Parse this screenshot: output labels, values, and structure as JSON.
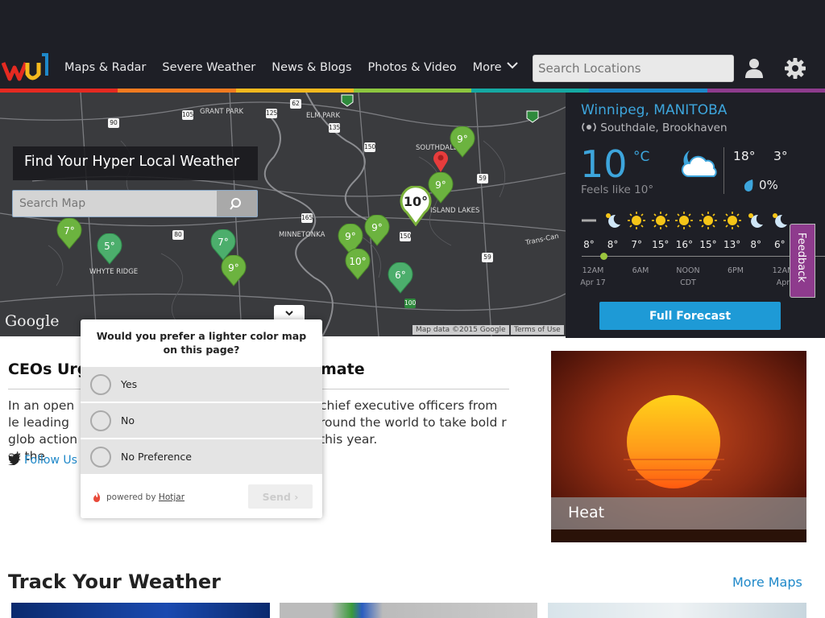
{
  "header": {
    "nav": [
      "Maps & Radar",
      "Severe Weather",
      "News & Blogs",
      "Photos & Video",
      "More"
    ],
    "search_placeholder": "Search Locations",
    "colorbar": [
      "#e52a21",
      "#f47b20",
      "#f5b91e",
      "#8cc63f",
      "#15a9a3",
      "#1e88c9",
      "#8e3b8d"
    ]
  },
  "map": {
    "find_title": "Find Your Hyper Local Weather",
    "search_placeholder": "Search Map",
    "google": "Google",
    "map_data": "Map data ©2015 Google",
    "terms": "Terms of Use",
    "zoom_in": "+",
    "zoom_out": "−",
    "current_pin": "10°",
    "pins": [
      "9°",
      "9°",
      "7°",
      "5°",
      "7°",
      "9°",
      "9°",
      "9°",
      "10°",
      "6°"
    ],
    "labels": [
      "GRANT PARK",
      "ELM PARK",
      "SOUTHDALE",
      "ISLAND LAKES",
      "MINNETONKA",
      "WHYTE RIDGE",
      "Trans-Can"
    ],
    "shields": [
      "90",
      "105",
      "125",
      "62",
      "135",
      "150",
      "59",
      "80",
      "165",
      "150",
      "59",
      "100"
    ]
  },
  "weather": {
    "city": "Winnipeg, MANITOBA",
    "station": "Southdale, Brookhaven",
    "temp": "10",
    "unit": "°C",
    "feels": "Feels like 10°",
    "hi": "18°",
    "lo": "3°",
    "precip": "0%",
    "forecast_icons": [
      "dash",
      "moon-sun",
      "sun",
      "sun",
      "sun",
      "sun",
      "sun",
      "moon-sun",
      "moon-sun"
    ],
    "forecast_temps": [
      "8°",
      "8°",
      "7°",
      "15°",
      "16°",
      "15°",
      "13°",
      "8°",
      "6°"
    ],
    "timeline": [
      {
        "t": "12AM",
        "sub": "Apr 17"
      },
      {
        "t": "6AM",
        "sub": ""
      },
      {
        "t": "NOON",
        "sub": "CDT"
      },
      {
        "t": "6PM",
        "sub": ""
      },
      {
        "t": "12AM",
        "sub": "Apr"
      }
    ],
    "full_forecast": "Full Forecast",
    "feedback": "Feedback"
  },
  "article": {
    "headline_left": "CEOs Urg",
    "headline_right": "mate",
    "body_left": "In an open le leading glob action at the",
    "body_right": "chief executive officers from round the world to take bold r this year.",
    "follow": "Follow Us"
  },
  "hero": {
    "label": "Heat"
  },
  "poll": {
    "question": "Would you prefer a lighter color map on this page?",
    "options": [
      "Yes",
      "No",
      "No Preference"
    ],
    "powered_by": "powered by",
    "brand": "Hotjar",
    "send": "Send"
  },
  "track": {
    "title": "Track Your Weather",
    "more": "More Maps"
  }
}
